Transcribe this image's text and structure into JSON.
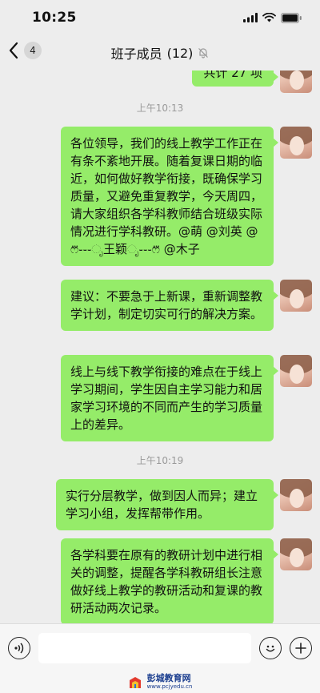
{
  "status_bar": {
    "time": "10:25"
  },
  "nav": {
    "back_badge": "4",
    "title": "班子成员",
    "member_count": "(12)"
  },
  "chat": {
    "partial_message": "共计 27 项",
    "time_1": "上午10:13",
    "time_2": "上午10:19",
    "messages": [
      "各位领导，我们的线上教学工作正在有条不紊地开展。随着复课日期的临近，如何做好教学衔接，既确保学习质量，又避免重复教学，今天周四，请大家组织各学科教师结合班级实际情况进行学科教研。@萌 @刘英 @ෆ⃛֊֊֊ೃ王颖ೃ֊֊֊ෆ⃛ @木子",
      "建议：不要急于上新课，重新调整教学计划，制定切实可行的解决方案。",
      "线上与线下教学衔接的难点在于线上学习期间，学生因自主学习能力和居家学习环境的不同而产生的学习质量上的差异。",
      "实行分层教学，做到因人而异；建立学习小组，发挥帮带作用。",
      "各学科要在原有的教研计划中进行相关的调整，提醒各学科教研组长注意做好线上教学的教研活动和复课的教研活动两次记录。"
    ]
  },
  "footer": {
    "name": "彭城教育网",
    "url": "www.pcjyedu.cn"
  },
  "colors": {
    "bubble": "#95ec69",
    "background": "#ededed"
  }
}
